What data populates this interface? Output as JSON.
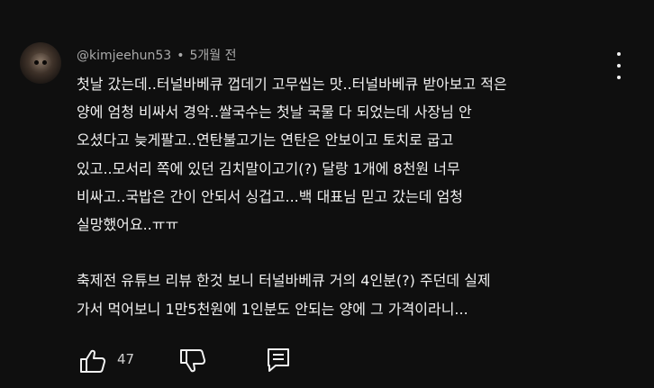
{
  "comment": {
    "author": "@kimjeehun53",
    "separator": "•",
    "time_ago": "5개월 전",
    "lines": [
      "첫날 갔는데..터널바베큐 껍데기 고무씹는 맛..터널바베큐 받아보고 적은",
      "양에 엄청 비싸서 경악..쌀국수는 첫날 국물 다 되었는데 사장님 안",
      "오셨다고 늦게팔고..연탄불고기는 연탄은 안보이고 토치로 굽고",
      "있고..모서리 쪽에 있던 김치말이고기(?) 달랑 1개에 8천원 너무",
      "비싸고..국밥은 간이 안되서 싱겁고...백 대표님 믿고 갔는데 엄청",
      "실망했어요..ㅠㅠ",
      "",
      "축제전 유튜브 리뷰 한것 보니 터널바베큐 거의 4인분(?) 주던데 실제",
      "가서 먹어보니 1만5천원에 1인분도 안되는 양에 그 가격이라니..."
    ],
    "like_count": "47"
  },
  "icons": {
    "avatar": "avatar",
    "more": "more-vert-icon",
    "like": "thumbs-up-icon",
    "dislike": "thumbs-down-icon",
    "reply": "reply-comment-icon"
  },
  "colors": {
    "background": "#0f0f0f",
    "text": "#f1f1f1",
    "secondary_text": "#aaaaaa"
  }
}
